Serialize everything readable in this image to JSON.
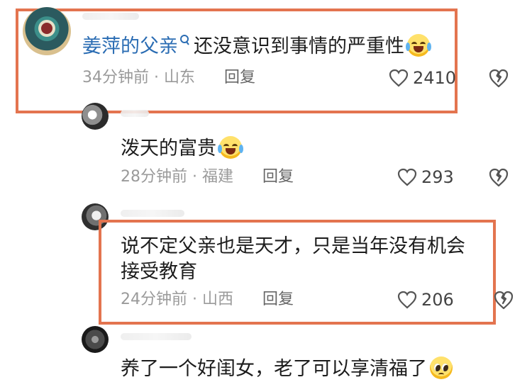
{
  "comments": [
    {
      "author": "姜萍的父亲",
      "text": "还没意识到事情的严重性",
      "time": "34分钟前",
      "location": "山东",
      "reply_label": "回复",
      "likes": "2410"
    },
    {
      "text": "泼天的富贵",
      "time": "28分钟前",
      "location": "福建",
      "reply_label": "回复",
      "likes": "293"
    },
    {
      "text_line1": "说不定父亲也是天才，只是当年没有机会",
      "text_line2": "接受教育",
      "time": "24分钟前",
      "location": "山西",
      "reply_label": "回复",
      "likes": "206"
    },
    {
      "text": "养了一个好闺女，老了可以享清福了"
    }
  ],
  "meta_separator": "·",
  "colors": {
    "highlight_frame": "#e3744f",
    "author_link": "#2a6cb3",
    "meta_text": "#9a9a9a"
  },
  "icons": {
    "like": "heart-outline-icon",
    "dislike": "broken-heart-icon",
    "emoji_laugh": "tears-of-joy-emoji",
    "emoji_plead": "pleading-face-emoji"
  }
}
